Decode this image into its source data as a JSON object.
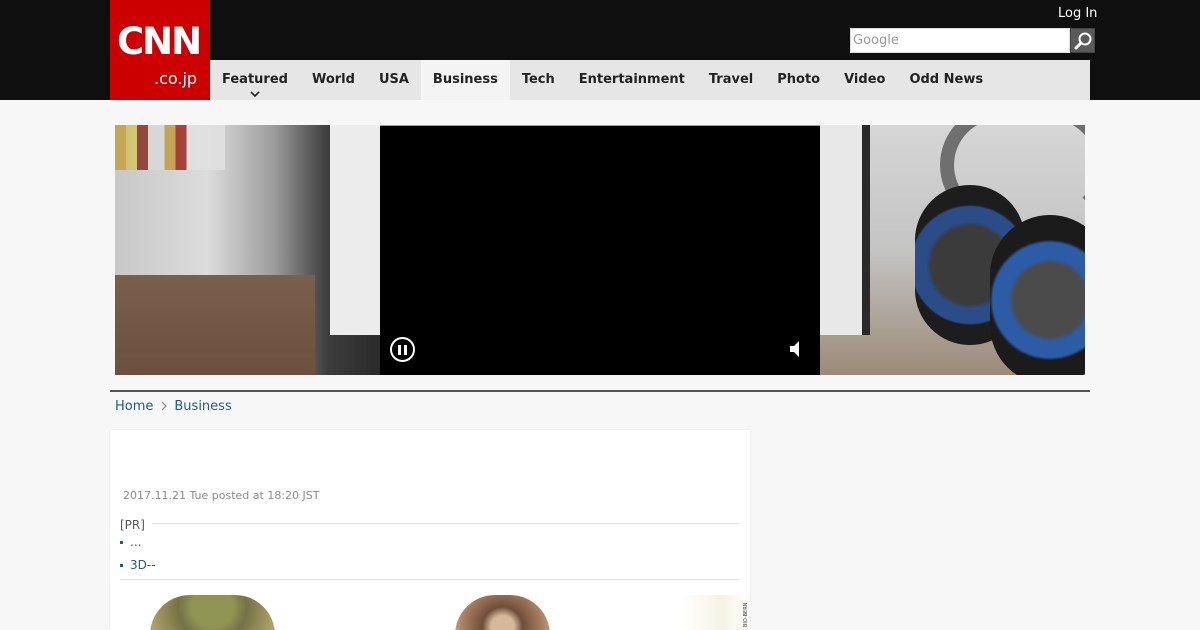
{
  "logo": {
    "brand": "CNN",
    "domain": ".co.jp"
  },
  "header": {
    "login_label": "Log In",
    "search_placeholder": "Google",
    "search_icon": "magnifier-icon"
  },
  "nav": {
    "items": [
      {
        "label": "Featured",
        "has_dropdown": true
      },
      {
        "label": "World"
      },
      {
        "label": "USA"
      },
      {
        "label": "Business",
        "active": true
      },
      {
        "label": "Tech"
      },
      {
        "label": "Entertainment"
      },
      {
        "label": "Travel"
      },
      {
        "label": "Photo"
      },
      {
        "label": "Video"
      },
      {
        "label": "Odd News"
      }
    ]
  },
  "video": {
    "pause_icon": "pause-icon",
    "mute_icon": "speaker-icon"
  },
  "breadcrumb": {
    "home": "Home",
    "current": "Business"
  },
  "article": {
    "posted": "2017.11.21 Tue posted at 18:20 JST",
    "pr_label": "[PR]",
    "pr_links": [
      "...",
      "3D--"
    ],
    "photo_side_text": "BIO-BERN"
  },
  "colors": {
    "brand_red": "#cc0000",
    "header_bg": "#0f0f10",
    "nav_bg": "#e6e6e6",
    "link": "#1f5a8b"
  }
}
